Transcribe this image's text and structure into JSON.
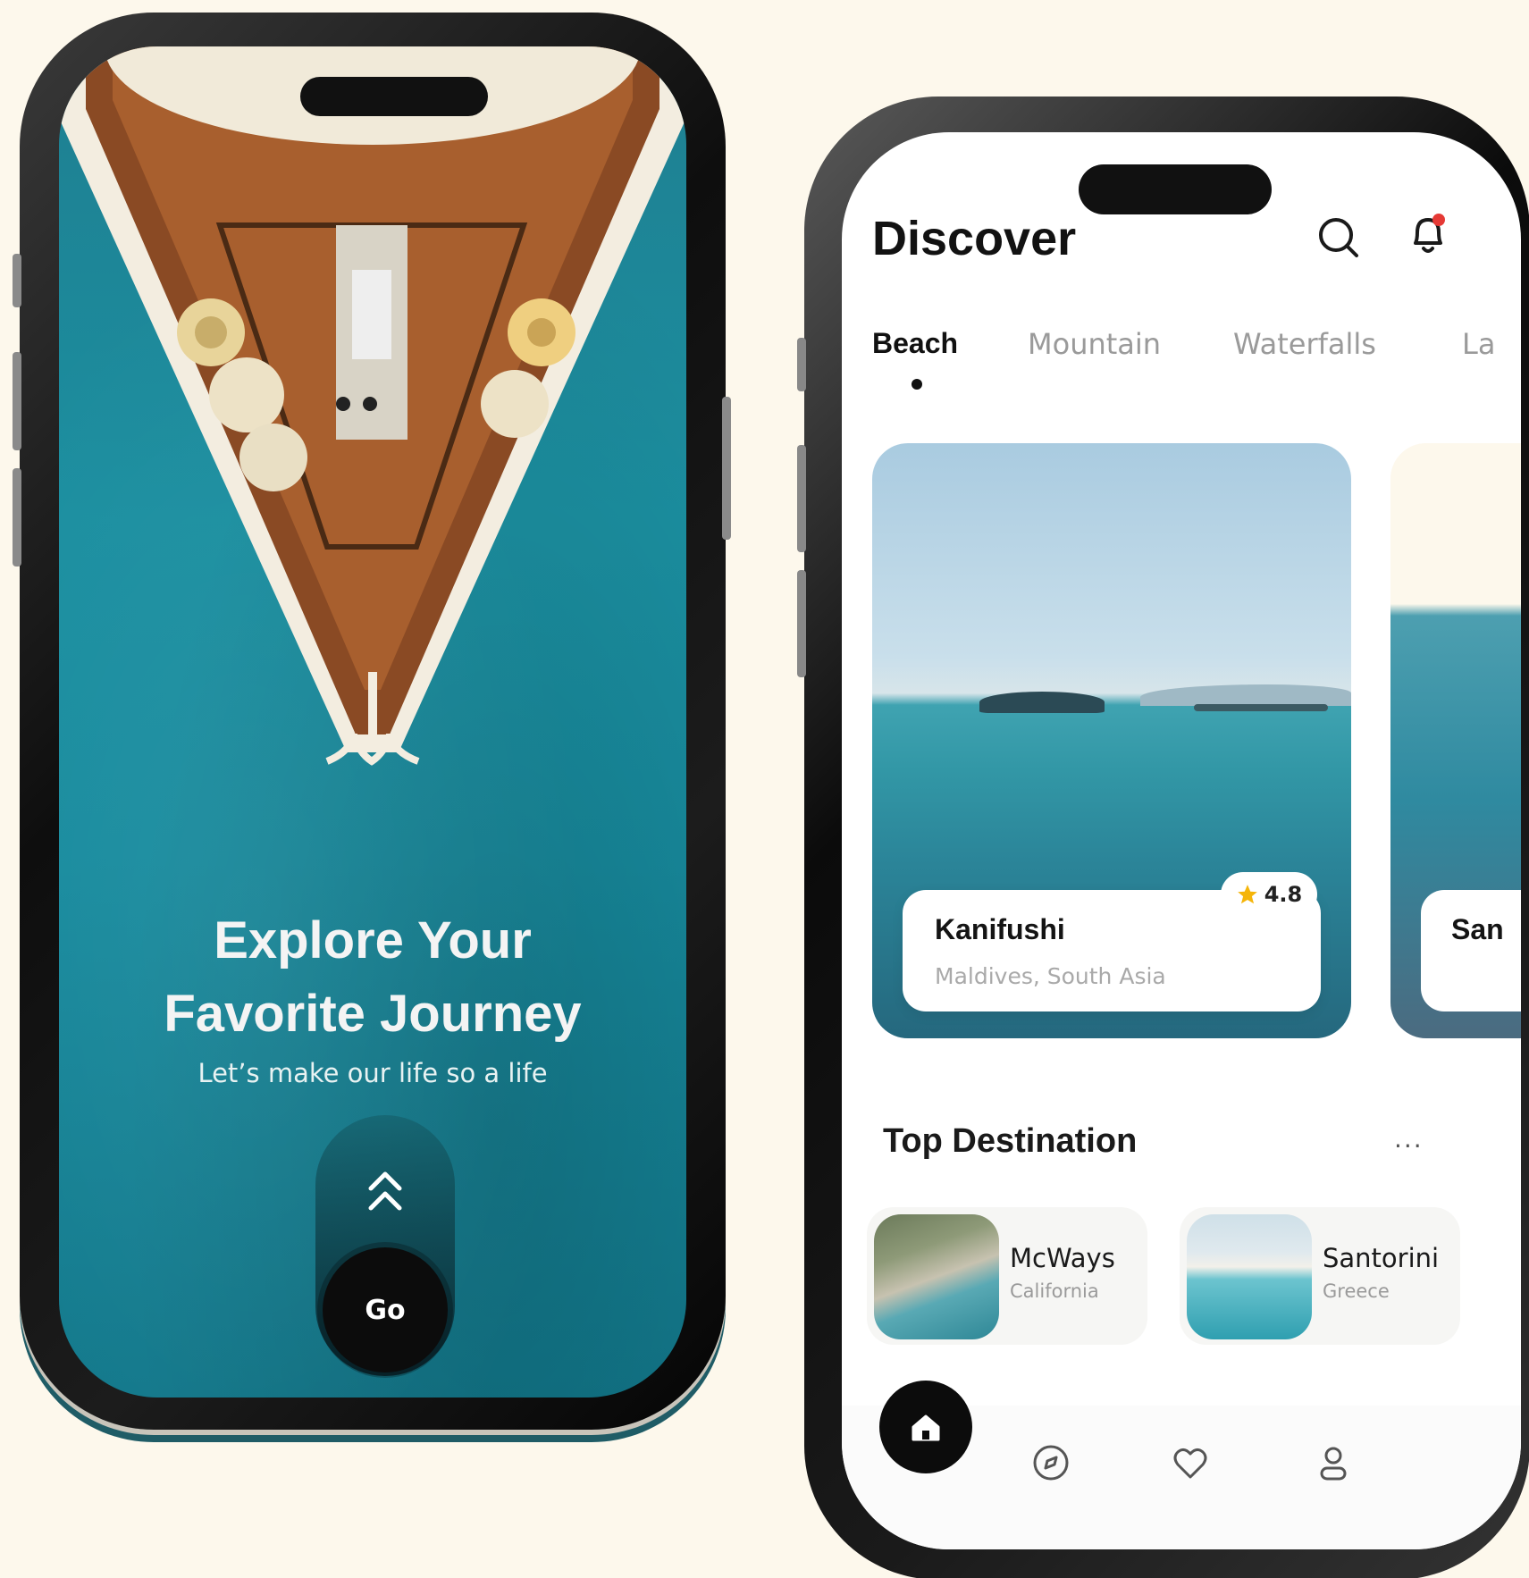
{
  "welcome": {
    "headline_line1": "Explore Your",
    "headline_line2": "Favorite Journey",
    "subtitle": "Let’s make our life so a life",
    "go_label": "Go"
  },
  "discover": {
    "title": "Discover",
    "tabs": [
      "Beach",
      "Mountain",
      "Waterfalls",
      "La"
    ],
    "active_tab": "Beach",
    "featured": [
      {
        "name": "Kanifushi",
        "location": "Maldives, South Asia",
        "rating": "4.8"
      },
      {
        "name": "San"
      }
    ],
    "section_title": "Top Destination",
    "more_label": "...",
    "destinations": [
      {
        "name": "McWays",
        "region": "California"
      },
      {
        "name": "Santorini",
        "region": "Greece"
      }
    ],
    "nav": [
      "home-icon",
      "compass-icon",
      "heart-icon",
      "profile-icon"
    ]
  },
  "colors": {
    "background": "#fdf8ec",
    "ocean": "#1b8fa0",
    "accent_dark": "#0c0c0c",
    "star": "#f5b50a",
    "notification": "#e53935"
  }
}
